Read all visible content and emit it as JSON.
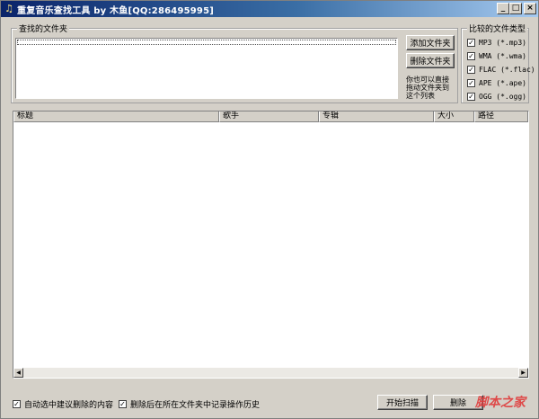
{
  "window": {
    "title": "重复音乐查找工具 by 木鱼[QQ:286495995]",
    "controls": {
      "minimize": "_",
      "maximize": "□",
      "close": "×"
    }
  },
  "folders": {
    "label": "查找的文件夹",
    "add_label": "添加文件夹",
    "remove_label": "删除文件夹",
    "hint": "你也可以直接\n拖动文件夹到\n这个列表"
  },
  "filetypes": {
    "label": "比较的文件类型",
    "items": [
      {
        "label": "MP3 (*.mp3)",
        "checked": true
      },
      {
        "label": "WMA (*.wma)",
        "checked": true
      },
      {
        "label": "FLAC (*.flac)",
        "checked": true
      },
      {
        "label": "APE (*.ape)",
        "checked": true
      },
      {
        "label": "OGG (*.ogg)",
        "checked": true
      }
    ]
  },
  "results": {
    "columns": [
      "标题",
      "歌手",
      "专辑",
      "大小",
      "路径"
    ]
  },
  "options": {
    "auto_select_label": "自动选中建议删除的内容",
    "auto_select_checked": true,
    "log_history_label": "删除后在所在文件夹中记录操作历史",
    "log_history_checked": true
  },
  "actions": {
    "scan_label": "开始扫描",
    "delete_label": "删除"
  },
  "watermark": "脚本之家"
}
